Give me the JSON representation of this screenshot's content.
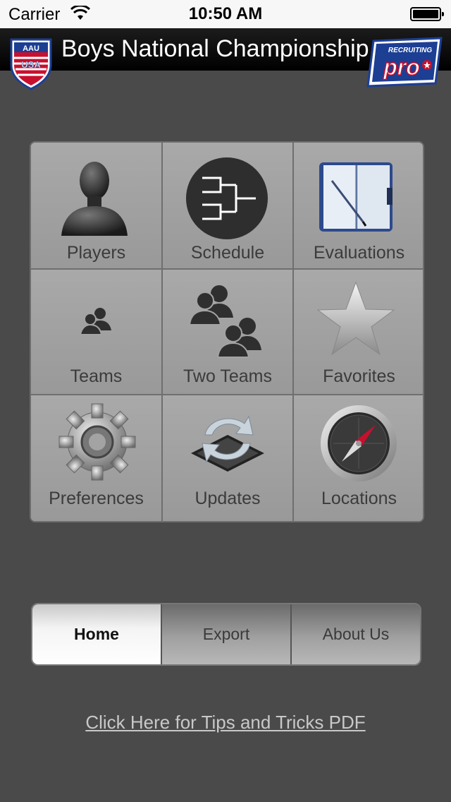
{
  "status_bar": {
    "carrier": "Carrier",
    "time": "10:50 AM"
  },
  "header": {
    "title": "Boys National Championship",
    "logo_left_text": "AAU",
    "logo_left_sub": "USA",
    "logo_right_top": "RECRUITING",
    "logo_right_main": "pro"
  },
  "grid": {
    "items": [
      {
        "label": "Players",
        "icon": "person-silhouette-icon"
      },
      {
        "label": "Schedule",
        "icon": "bracket-icon"
      },
      {
        "label": "Evaluations",
        "icon": "notebook-pen-icon"
      },
      {
        "label": "Teams",
        "icon": "team-small-icon"
      },
      {
        "label": "Two Teams",
        "icon": "two-teams-icon"
      },
      {
        "label": "Favorites",
        "icon": "star-icon"
      },
      {
        "label": "Preferences",
        "icon": "gear-icon"
      },
      {
        "label": "Updates",
        "icon": "sync-icon"
      },
      {
        "label": "Locations",
        "icon": "compass-icon"
      }
    ]
  },
  "tabbar": {
    "tabs": [
      {
        "label": "Home",
        "active": true
      },
      {
        "label": "Export",
        "active": false
      },
      {
        "label": "About Us",
        "active": false
      }
    ]
  },
  "tips_link": "Click Here for Tips and Tricks PDF",
  "colors": {
    "background": "#4a4a4a",
    "cell": "#a3a3a3",
    "aau_red": "#c8102e",
    "aau_blue": "#1c3f94"
  }
}
